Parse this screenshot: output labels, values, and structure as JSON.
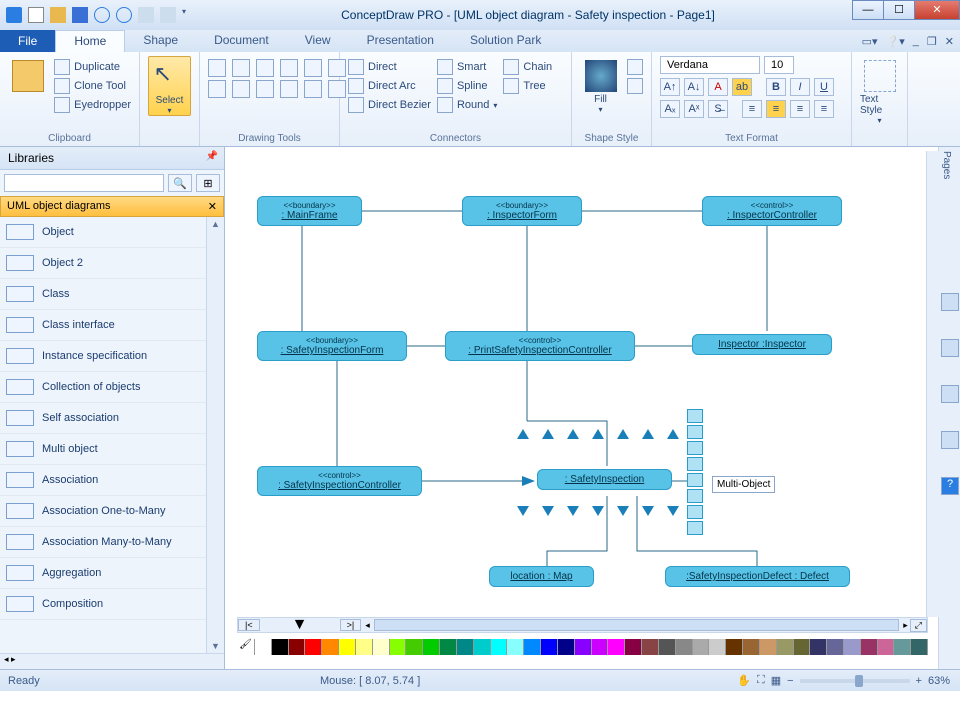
{
  "title": "ConceptDraw PRO - [UML object diagram - Safety inspection - Page1]",
  "fileTab": "File",
  "tabs": [
    "Home",
    "Shape",
    "Document",
    "View",
    "Presentation",
    "Solution Park"
  ],
  "activeTab": 0,
  "ribbon": {
    "clipboard": {
      "duplicate": "Duplicate",
      "clone": "Clone Tool",
      "eyedrop": "Eyedropper",
      "label": "Clipboard"
    },
    "select": {
      "label": "Select"
    },
    "drawing": {
      "label": "Drawing Tools"
    },
    "connectors": {
      "direct": "Direct",
      "directArc": "Direct Arc",
      "directBez": "Direct Bezier",
      "smart": "Smart",
      "spline": "Spline",
      "round": "Round",
      "chain": "Chain",
      "tree": "Tree",
      "label": "Connectors"
    },
    "fill": {
      "label": "Fill"
    },
    "shapeStyle": {
      "label": "Shape Style"
    },
    "font": {
      "name": "Verdana",
      "size": "10",
      "label": "Text Format"
    },
    "textStyle": {
      "label": "Text Style"
    }
  },
  "libraries": {
    "title": "Libraries",
    "section": "UML object diagrams",
    "items": [
      "Object",
      "Object 2",
      "Class",
      "Class interface",
      "Instance specification",
      "Collection of objects",
      "Self association",
      "Multi object",
      "Association",
      "Association One-to-Many",
      "Association Many-to-Many",
      "Aggregation",
      "Composition"
    ]
  },
  "nodes": {
    "mainframe": {
      "ster": "<<boundary>>",
      "nm": ": MainFrame"
    },
    "inspForm": {
      "ster": "<<boundary>>",
      "nm": ": InspectorForm"
    },
    "inspCtrl": {
      "ster": "<<control>>",
      "nm": ": InspectorController"
    },
    "safForm": {
      "ster": "<<boundary>>",
      "nm": ": SafetyInspectionForm"
    },
    "printCtrl": {
      "ster": "<<control>>",
      "nm": ": PrintSafetyInspectionController"
    },
    "inspector": {
      "nm": "Inspector :Inspector"
    },
    "safCtrl": {
      "ster": "<<control>>",
      "nm": ": SafetyInspectionController"
    },
    "safInsp": {
      "nm": ": SafetyInspection"
    },
    "location": {
      "nm": "location : Map"
    },
    "defect": {
      "nm": ":SafetyInspectionDefect : Defect"
    }
  },
  "tooltip": "Multi-Object",
  "pagesLabel": "Pages",
  "status": {
    "ready": "Ready",
    "mouse": "Mouse: [ 8.07, 5.74 ]",
    "zoom": "63%"
  },
  "paletteColors": [
    "#fff",
    "#000",
    "#800",
    "#f00",
    "#f80",
    "#ff0",
    "#ff8",
    "#ffc",
    "#8f0",
    "#4c0",
    "#0c0",
    "#084",
    "#088",
    "#0cc",
    "#0ff",
    "#8ff",
    "#08f",
    "#00f",
    "#008",
    "#80f",
    "#c0f",
    "#f0f",
    "#804",
    "#844",
    "#555",
    "#888",
    "#aaa",
    "#ccc",
    "#630",
    "#963",
    "#c96",
    "#996",
    "#663",
    "#336",
    "#669",
    "#99c",
    "#936",
    "#c69",
    "#699",
    "#366"
  ]
}
